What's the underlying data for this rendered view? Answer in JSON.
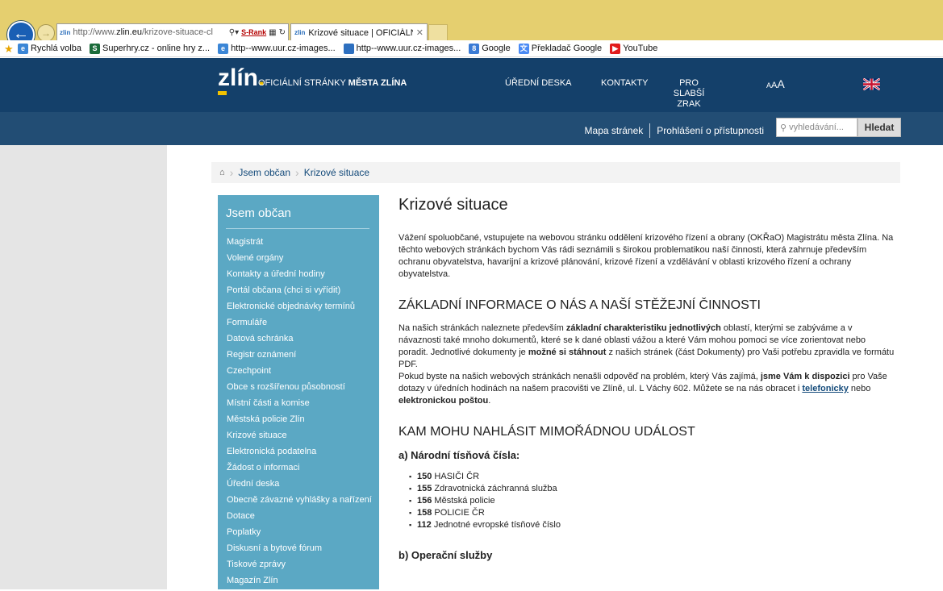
{
  "browser": {
    "address_fav": "zlin",
    "address_url_prefix": "http://www.",
    "address_url_domain": "zlin.eu",
    "address_url_rest": "/krizove-situace-cl",
    "address_srank": "S-Rank",
    "tab_fav": "zlin",
    "tab_title": "Krizové situace | OFICIÁLNÍ ...",
    "favorites": [
      {
        "label": "Rychlá volba",
        "icon": "page-icon"
      },
      {
        "label": "Superhry.cz - online hry z...",
        "icon": "superhry-icon"
      },
      {
        "label": "http--www.uur.cz-images...",
        "icon": "page-icon"
      },
      {
        "label": "http--www.uur.cz-images...",
        "icon": "image-icon"
      },
      {
        "label": "Google",
        "icon": "google-icon"
      },
      {
        "label": "Překladač Google",
        "icon": "translate-icon"
      },
      {
        "label": "YouTube",
        "icon": "youtube-icon"
      }
    ]
  },
  "header": {
    "logo": "zlín",
    "logo_dot": ".",
    "title_prefix": "OFICIÁLNÍ STRÁNKY ",
    "title_bold": "MĚSTA ZLÍNA",
    "nav_deska": "ÚŘEDNÍ DESKA",
    "nav_kontakty": "KONTAKTY",
    "nav_slabsi": "PRO SLABŠÍ ZRAK",
    "font_small": "A",
    "font_mid": "A",
    "font_large": "A",
    "sitemap": "Mapa stránek",
    "accessibility": "Prohlášení o přístupnosti",
    "search_placeholder": "vyhledávání...",
    "search_button": "Hledat"
  },
  "breadcrumb": {
    "items": [
      "Jsem občan",
      "Krizové situace"
    ]
  },
  "sidebar": {
    "title": "Jsem občan",
    "items": [
      "Magistrát",
      "Volené orgány",
      "Kontakty a úřední hodiny",
      "Portál občana (chci si vyřídit)",
      "Elektronické objednávky termínů",
      "Formuláře",
      "Datová schránka",
      "Registr oznámení",
      "Czechpoint",
      "Obce s rozšířenou působností",
      "Místní části a komise",
      "Městská policie Zlín",
      "Krizové situace",
      "Elektronická podatelna",
      "Žádost o informaci",
      "Úřední deska",
      "Obecně závazné vyhlášky a nařízení",
      "Dotace",
      "Poplatky",
      "Diskusní a bytové fórum",
      "Tiskové zprávy",
      "Magazín Zlín"
    ]
  },
  "content": {
    "title": "Krizové situace",
    "intro": "Vážení spoluobčané, vstupujete na webovou stránku oddělení krizového řízení a obrany (OKŘaO) Magistrátu města Zlína. Na těchto webových stránkách bychom Vás rádi seznámili s širokou problematikou naší činnosti, která zahrnuje především ochranu obyvatelstva, havarijní a krizové plánování, krizové řízení a vzdělávání v oblasti krizového řízení a ochrany obyvatelstva.",
    "h2_basic": "ZÁKLADNÍ INFORMACE O NÁS A NAŠÍ STĚŽEJNÍ ČINNOSTI",
    "p1_a": "Na našich stránkách naleznete především ",
    "p1_b": "základní charakteristiku jednotlivých",
    "p1_c": " oblastí, kterými se zabýváme a v návaznosti také mnoho dokumentů, které se k dané oblasti vážou a které Vám mohou pomoci se více zorientovat nebo poradit. Jednotlivé dokumenty je ",
    "p1_d": "možné si stáhnout",
    "p1_e": " z našich stránek (část Dokumenty) pro Vaši potřebu zpravidla ve formátu PDF.",
    "p2_a": "Pokud byste na našich webových stránkách nenašli odpověď na problém, který Vás zajímá, ",
    "p2_b": "jsme Vám k dispozici",
    "p2_c": " pro Vaše dotazy v úředních hodinách na našem pracovišti ve Zlíně, ul. L Váchy 602. Můžete se na nás obracet i ",
    "p2_link": "telefonicky",
    "p2_d": " nebo ",
    "p2_e": "elektronickou poštou",
    "p2_f": ".",
    "h2_report": "KAM MOHU NAHLÁSIT MIMOŘÁDNOU UDÁLOST",
    "h3_national": "a) Národní tísňová čísla:",
    "numbers": [
      {
        "num": "150",
        "label": "HASIČI ČR"
      },
      {
        "num": "155",
        "label": "Zdravotnická záchranná služba"
      },
      {
        "num": "156",
        "label": "Městská policie"
      },
      {
        "num": "158",
        "label": "POLICIE ČR"
      },
      {
        "num": "112",
        "label": "Jednotné evropské tísňové číslo"
      }
    ],
    "h3_operational": "b) Operační služby"
  }
}
